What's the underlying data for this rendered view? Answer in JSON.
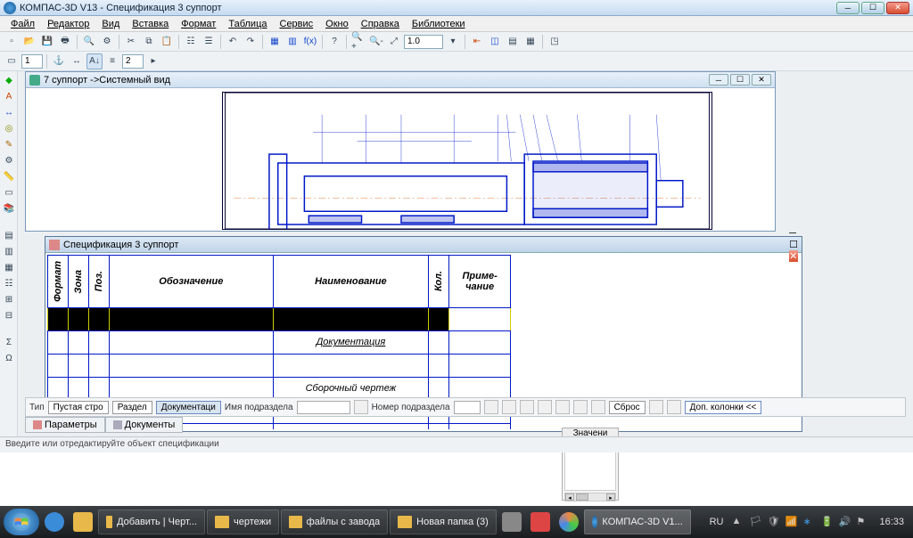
{
  "app": {
    "title": "КОМПАС-3D V13 - Спецификация 3 суппорт"
  },
  "menu": [
    "Файл",
    "Редактор",
    "Вид",
    "Вставка",
    "Формат",
    "Таблица",
    "Сервис",
    "Окно",
    "Справка",
    "Библиотеки"
  ],
  "toolbar1": {
    "zoom_value": "1.0"
  },
  "toolbar2": {
    "num1": "1",
    "num2": "2"
  },
  "mdi_drawing": {
    "title": "7 суппорт ->Системный вид"
  },
  "mdi_spec": {
    "title": "Спецификация 3 суппорт"
  },
  "spec_headers": {
    "format": "Формат",
    "zone": "Зона",
    "pos": "Поз.",
    "designation": "Обозначение",
    "name": "Наименование",
    "qty": "Кол.",
    "note": "Приме-\nчание"
  },
  "spec_rows": {
    "r2_name": "Документация",
    "r4_name": "Сборочный чертеж"
  },
  "float_panel": {
    "header": "Значени"
  },
  "propbar": {
    "type_lbl": "Тип",
    "btn_empty": "Пустая стро",
    "btn_section": "Раздел",
    "btn_doc": "Документаци",
    "sub_name_lbl": "Имя подраздела",
    "sub_num_lbl": "Номер подраздела",
    "reset": "Сброс",
    "extra_cols": "Доп. колонки  <<"
  },
  "tabs": {
    "params": "Параметры",
    "docs": "Документы"
  },
  "status": "Введите или отредактируйте объект спецификации",
  "taskbar": {
    "items": [
      "Добавить | Черт...",
      "чертежи",
      "файлы с завода",
      "Новая папка (3)"
    ],
    "app_item": "КОМПАС-3D V1...",
    "lang": "RU",
    "time": "16:33"
  }
}
